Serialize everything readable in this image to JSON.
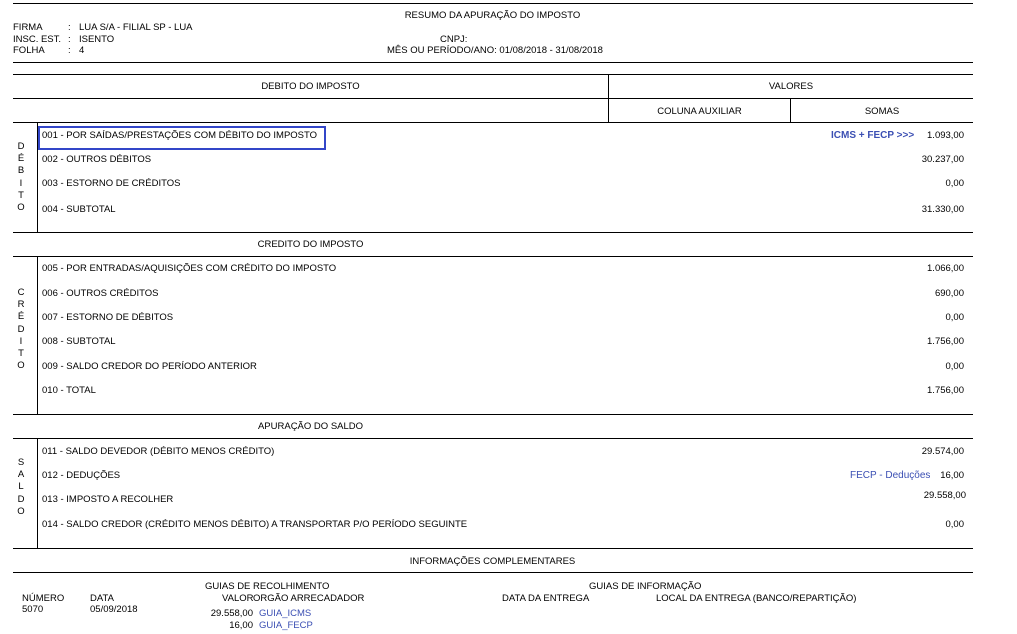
{
  "header": {
    "title": "RESUMO DA APURAÇÃO DO IMPOSTO",
    "firma_label": "FIRMA",
    "firma_value": "LUA S/A - FILIAL SP - LUA",
    "insc_label": "INSC. EST.",
    "insc_value": "ISENTO",
    "folha_label": "FOLHA",
    "folha_value": "4",
    "colon": ":",
    "cnpj_label": "CNPJ:",
    "periodo": "MÊS OU PERÍODO/ANO: 01/08/2018 - 31/08/2018"
  },
  "columns": {
    "debito_header": "DEBITO DO IMPOSTO",
    "valores": "VALORES",
    "coluna_auxiliar": "COLUNA AUXILIAR",
    "somas": "SOMAS"
  },
  "debito": {
    "side_label": [
      "D",
      "É",
      "B",
      "I",
      "T",
      "O"
    ],
    "rows": [
      {
        "label": "001 - POR SAÍDAS/PRESTAÇÕES COM DÉBITO DO IMPOSTO",
        "value": "1.093,00",
        "link": "ICMS + FECP >>>"
      },
      {
        "label": "002 - OUTROS DÉBITOS",
        "value": "30.237,00"
      },
      {
        "label": "003 - ESTORNO DE CRÉDITOS",
        "value": "0,00"
      },
      {
        "label": "004 - SUBTOTAL",
        "value": "31.330,00"
      }
    ]
  },
  "credito": {
    "header": "CREDITO DO IMPOSTO",
    "side_label": [
      "C",
      "R",
      "É",
      "D",
      "I",
      "T",
      "O"
    ],
    "rows": [
      {
        "label": "005 - POR ENTRADAS/AQUISIÇÕES COM CRÉDITO DO IMPOSTO",
        "value": "1.066,00"
      },
      {
        "label": "006 - OUTROS CRÉDITOS",
        "value": "690,00"
      },
      {
        "label": "007 - ESTORNO DE DÉBITOS",
        "value": "0,00"
      },
      {
        "label": "008 - SUBTOTAL",
        "value": "1.756,00"
      },
      {
        "label": "009 - SALDO CREDOR DO PERÍODO ANTERIOR",
        "value": "0,00"
      },
      {
        "label": "010 - TOTAL",
        "value": "1.756,00"
      }
    ]
  },
  "saldo": {
    "header": "APURAÇÃO DO SALDO",
    "side_label": [
      "S",
      "A",
      "L",
      "D",
      "O"
    ],
    "rows": [
      {
        "label": "011 - SALDO DEVEDOR (DÉBITO MENOS CRÉDITO)",
        "value": "29.574,00"
      },
      {
        "label": "012 - DEDUÇÕES",
        "value": "16,00",
        "link": "FECP - Deduções"
      },
      {
        "label": "013 - IMPOSTO A RECOLHER",
        "value": "29.558,00"
      },
      {
        "label": "014 - SALDO CREDOR (CRÉDITO MENOS DÉBITO) A TRANSPORTAR P/O PERÍODO SEGUINTE",
        "value": "0,00"
      }
    ]
  },
  "info": {
    "header": "INFORMAÇÕES COMPLEMENTARES",
    "guias_recolhimento": "GUIAS DE RECOLHIMENTO",
    "guias_informacao": "GUIAS DE INFORMAÇÃO",
    "numero_label": "NÚMERO",
    "numero_value": "5070",
    "data_label": "DATA",
    "data_value": "05/09/2018",
    "valor_label": "VALOR",
    "orgao_label": "ORGÃO ARRECADADOR",
    "data_entrega_label": "DATA DA ENTREGA",
    "local_entrega_label": "LOCAL DA ENTREGA (BANCO/REPARTIÇÃO)",
    "guias": [
      {
        "valor": "29.558,00",
        "link": "GUIA_ICMS"
      },
      {
        "valor": "16,00",
        "link": "GUIA_FECP"
      }
    ]
  }
}
